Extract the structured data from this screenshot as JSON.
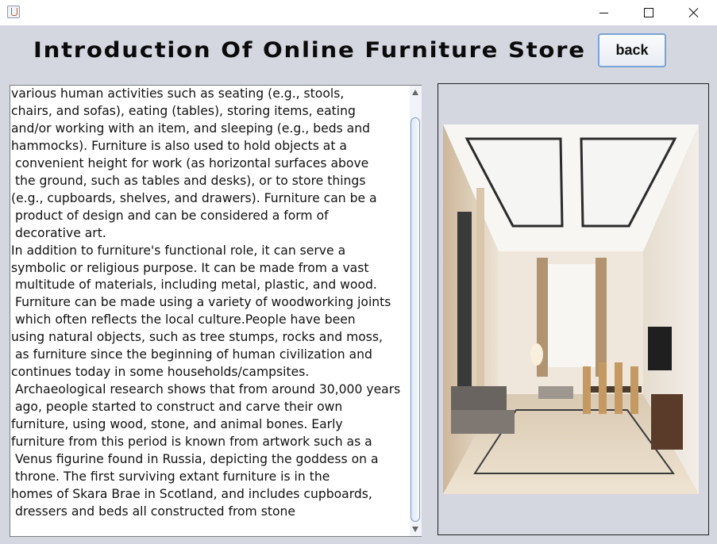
{
  "window": {
    "title": "",
    "controls": {
      "minimize_icon": "minimize-icon",
      "maximize_icon": "maximize-icon",
      "close_icon": "close-icon"
    }
  },
  "header": {
    "title": "Introduction Of Online Furniture Store",
    "back_label": "back"
  },
  "content": {
    "text": "various human activities such as seating (e.g., stools,\nchairs, and sofas), eating (tables), storing items, eating\nand/or working with an item, and sleeping (e.g., beds and\nhammocks). Furniture is also used to hold objects at a\n convenient height for work (as horizontal surfaces above\n the ground, such as tables and desks), or to store things\n(e.g., cupboards, shelves, and drawers). Furniture can be a\n product of design and can be considered a form of\n decorative art.\nIn addition to furniture's functional role, it can serve a\nsymbolic or religious purpose. It can be made from a vast\n multitude of materials, including metal, plastic, and wood.\n Furniture can be made using a variety of woodworking joints\n which often reflects the local culture.People have been\nusing natural objects, such as tree stumps, rocks and moss,\n as furniture since the beginning of human civilization and\ncontinues today in some households/campsites.\n Archaeological research shows that from around 30,000 years\n ago, people started to construct and carve their own\nfurniture, using wood, stone, and animal bones. Early\nfurniture from this period is known from artwork such as a\n Venus figurine found in Russia, depicting the goddess on a\n throne. The first surviving extant furniture is in the\nhomes of Skara Brae in Scotland, and includes cupboards,\n dressers and beds all constructed from stone"
  },
  "colors": {
    "background": "#d4d6e0",
    "button_border": "#7aa3d8",
    "text": "#111111"
  }
}
